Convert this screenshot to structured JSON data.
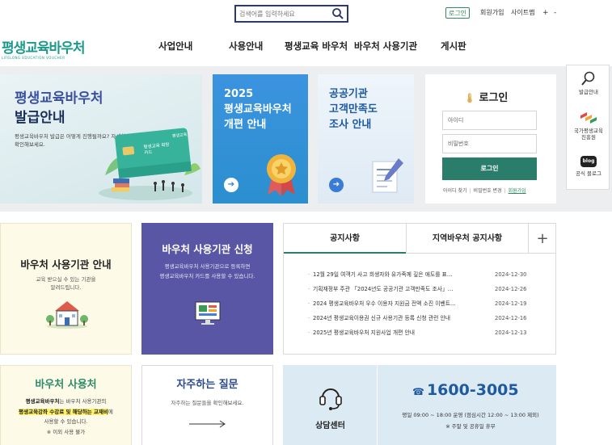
{
  "topbar": {
    "search_placeholder": "검색어를 입력하세요",
    "login": "로그인",
    "join": "회원가입",
    "sitemap": "사이트맵",
    "font_plus": "+",
    "font_minus": "-"
  },
  "logo": {
    "name": "평생교육바우처",
    "sub": "LIFELONG EDUCATION VOUCHER"
  },
  "nav": [
    "사업안내",
    "사용안내",
    "평생교육 바우처",
    "바우처 사용기관",
    "게시판"
  ],
  "hero": {
    "title_line1": "평생교육바우처",
    "title_line2": "발급안내",
    "desc": "평생교육바우처 발급은 어떻게 진행될까요? 자세한 정보를 확인해보세요.",
    "card_brand": "평생교육",
    "card_label": "평생교육 희망카드"
  },
  "card_2025": {
    "line1": "2025",
    "line2": "평생교육바우처",
    "line3": "개편 안내"
  },
  "card_public": {
    "line1": "공공기관",
    "line2": "고객만족도",
    "line3": "조사 안내"
  },
  "login_panel": {
    "title": "로그인",
    "id_placeholder": "아이디",
    "pw_placeholder": "비밀번호",
    "submit": "로그인",
    "find_id": "아이디 찾기",
    "change_pw": "비밀번호 변경",
    "join": "회원가입"
  },
  "quick": [
    {
      "label": "발급안내",
      "icon": "magnifier-icon"
    },
    {
      "label": "국가평생교육\n진흥원",
      "icon": "nile-logo-icon"
    },
    {
      "label": "공식 블로그",
      "icon": "blog-icon",
      "badge": "blog"
    }
  ],
  "voucher_org": {
    "title": "바우처 사용기관 안내",
    "desc": "교육 받으실 수 있는 기관을\n알려드립니다."
  },
  "apply": {
    "title": "바우처 사용기관 신청",
    "desc": "평생교육바우처 사용기관으로 등록하면\n평생교육바우처 카드를 사용할 수 있습니다."
  },
  "notice": {
    "tab_notice": "공지사항",
    "tab_regional": "지역바우처 공지사항",
    "more": "+",
    "items": [
      {
        "title": "12월 29일 여객기 사고 희생자와 유가족께 깊은 애도를 표…",
        "date": "2024-12-30"
      },
      {
        "title": "기획재정부 주관 「2024년도 공공기관 고객만족도 조사」…",
        "date": "2024-12-26"
      },
      {
        "title": "2024 평생교육바우처 우수 이용자 지원금 전액 소진 이벤트…",
        "date": "2024-12-19"
      },
      {
        "title": "2024년 평생교육이용권 신규 사용기관 등록 신청 관련 안내",
        "date": "2024-12-16"
      },
      {
        "title": "2025년 평생교육바우처 지원사업 개편 안내",
        "date": "2024-12-13"
      }
    ]
  },
  "usage": {
    "title": "바우처 사용처",
    "line1_bold": "평생교육바우처",
    "line1_rest": "는 바우처 사용기관의",
    "line2_hl": "평생교육강좌 수강료 및 해당하는 교재비",
    "line2_rest": "에",
    "line3": "사용할 수 있습니다.",
    "line4": "※ 이외 사용 불가"
  },
  "faq": {
    "title": "자주하는 질문",
    "desc": "자주하는 질문들을 확인해보세요."
  },
  "center": {
    "title": "상담센터",
    "phone": "1600-3005",
    "phone_icon": "☎",
    "hours1": "평일 09:00 ~ 18:00 운영 (점심시간 12:00 ~ 13:00 제외)",
    "hours2": "※ 주말 및 공휴일 휴무"
  },
  "colors": {
    "brand": "#1a9a8a",
    "login_green": "#2a7d6b",
    "apply_purple": "#5a56a6",
    "card_blue": "#2b8fcf"
  }
}
